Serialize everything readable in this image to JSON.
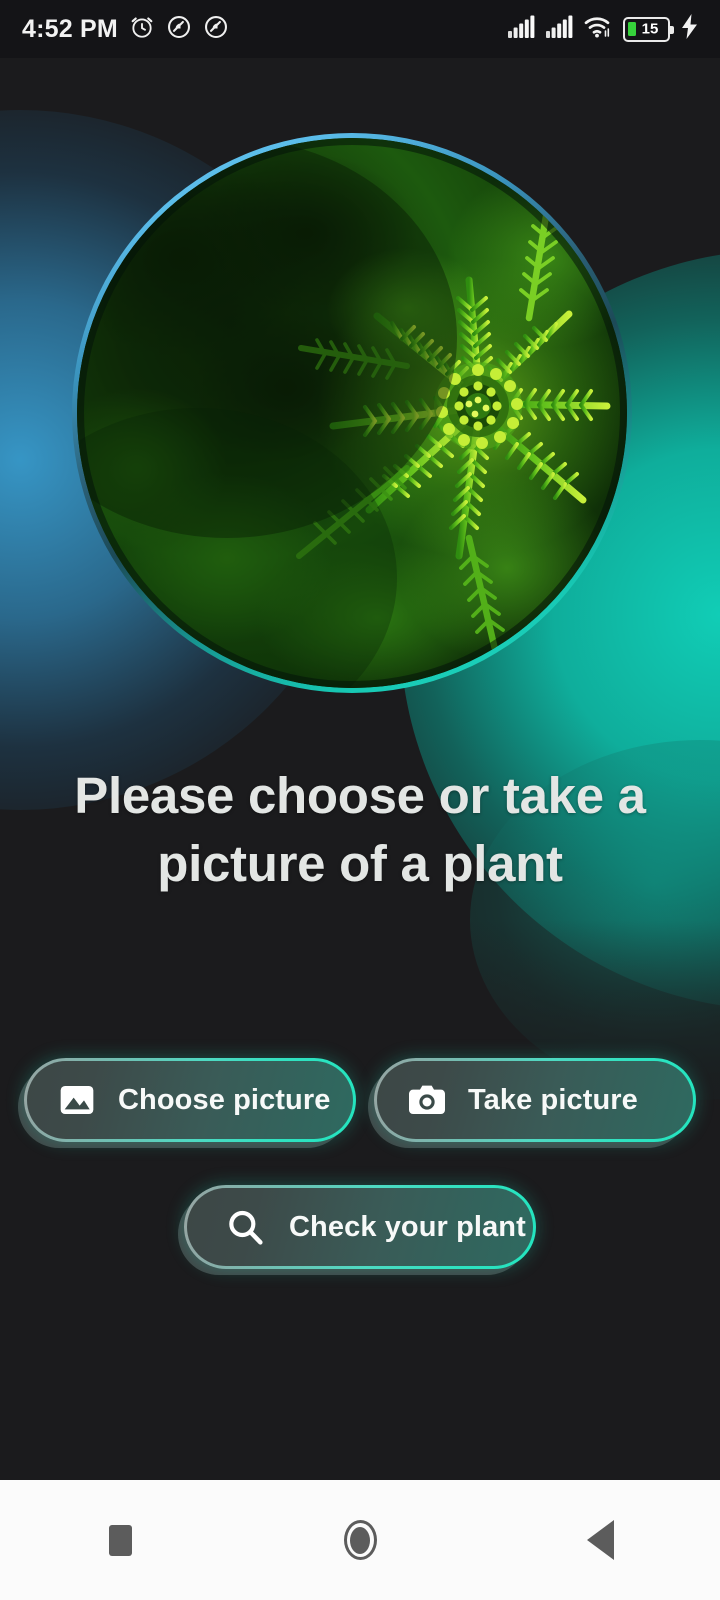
{
  "status_bar": {
    "time": "4:52 PM",
    "icons_left": [
      "alarm-clock-icon",
      "dnd-icon",
      "mute-icon"
    ],
    "icons_right": [
      "signal-bars-sim1-icon",
      "signal-bars-sim2-icon",
      "wifi-icon"
    ],
    "battery_level": "15",
    "battery_charging": true,
    "battery_fill_color": "#36d23b"
  },
  "hero": {
    "image_alt": "plant-photo",
    "ring_colors": [
      "#6cc3ef",
      "#2a5e74",
      "#22d8c2"
    ]
  },
  "main": {
    "heading": "Please choose or take a picture of a plant"
  },
  "buttons": {
    "choose_picture": {
      "label": "Choose picture",
      "icon": "image-icon"
    },
    "take_picture": {
      "label": "Take picture",
      "icon": "camera-icon"
    },
    "check_plant": {
      "label": "Check your plant",
      "icon": "search-icon"
    },
    "accent_color": "#23e4bf",
    "fill_color": "#3a5b57"
  },
  "nav_bar": {
    "recents_label": "recents",
    "home_label": "home",
    "back_label": "back",
    "icon_color": "#5c5c5c",
    "background": "#fbfbfb"
  },
  "theme": {
    "background": "#1b1b1d",
    "blue_glow": "#389cce",
    "teal_glow": "#11cdb6",
    "heading_color": "#e3e6e4"
  }
}
